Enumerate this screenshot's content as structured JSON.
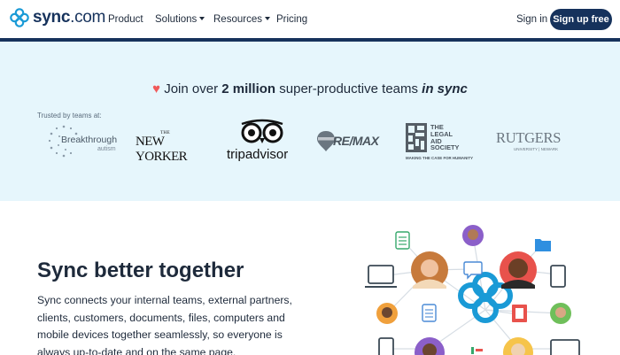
{
  "nav": {
    "logo_text": "sync",
    "logo_suffix": ".com",
    "menu": [
      "Product",
      "Solutions",
      "Resources",
      "Pricing"
    ],
    "sign_in": "Sign in",
    "sign_up": "Sign up free"
  },
  "trust": {
    "headline_pre": "Join over ",
    "headline_bold": "2 million",
    "headline_mid": " super-productive teams ",
    "headline_italic": "in sync",
    "trusted_label": "Trusted by teams at:",
    "brands": {
      "breakthrough": "Breakthrough",
      "breakthrough_sub": "autism",
      "newyorker": "NEW YORKER",
      "newyorker_the": "THE",
      "tripadvisor": "tripadvisor",
      "remax": "RE/MAX",
      "legalaid_lines": [
        "THE",
        "LEGAL",
        "AID",
        "SOCIETY"
      ],
      "legalaid_tag": "MAKING THE CASE FOR HUMANITY",
      "rutgers": "RUTGERS",
      "rutgers_sub": "UNIVERSITY | NEWARK"
    }
  },
  "hero": {
    "title": "Sync better together",
    "body": "Sync connects your internal teams, external partners, clients, customers, documents, files, computers and mobile devices together seamlessly, so everyone is always up-to-date and on the same page."
  },
  "colors": {
    "navy": "#16325c",
    "band": "#e6f6fc",
    "accent_blue": "#1a9ad6",
    "heart": "#f05a5a"
  }
}
